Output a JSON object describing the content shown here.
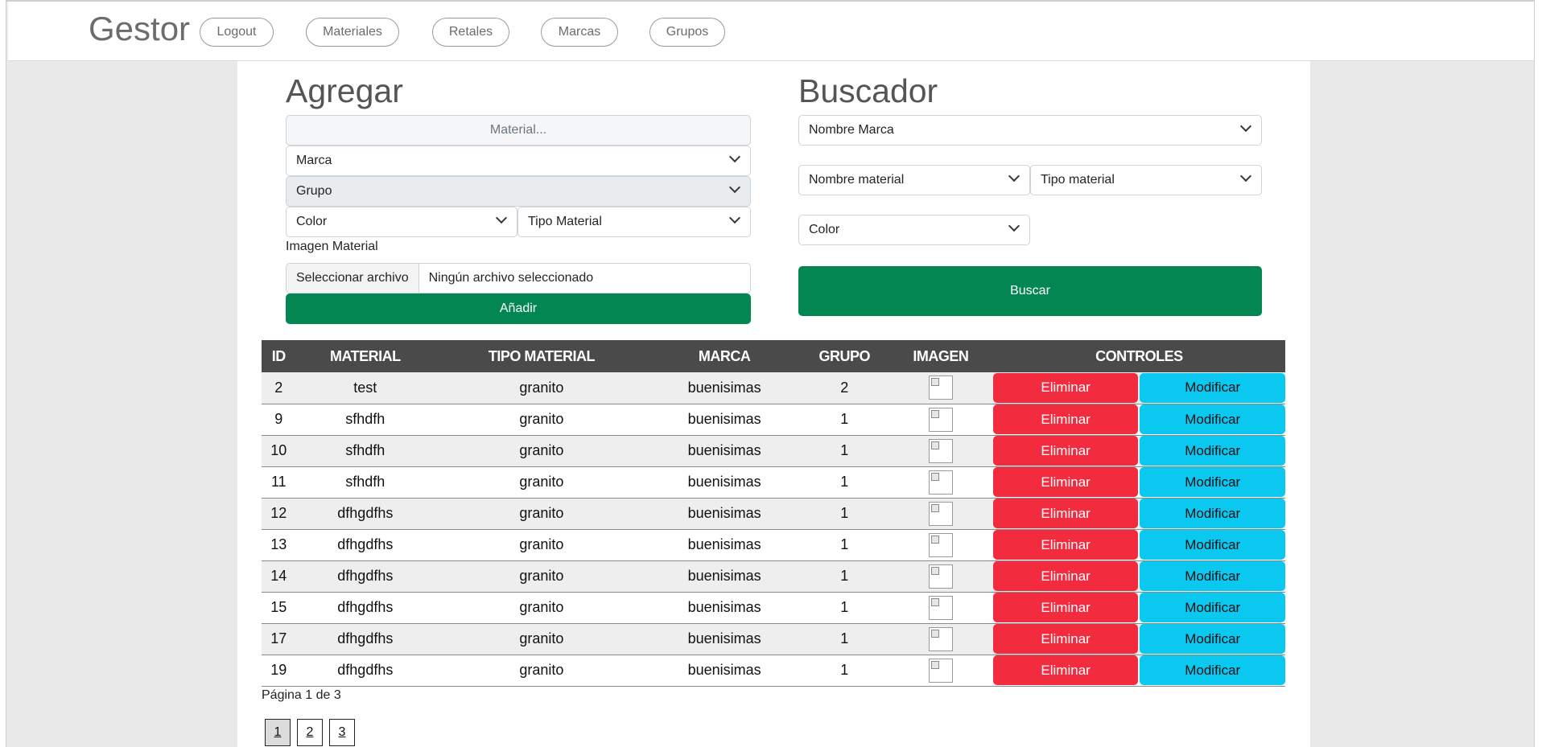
{
  "navbar": {
    "brand": "Gestor",
    "items": [
      "Logout",
      "Materiales",
      "Retales",
      "Marcas",
      "Grupos"
    ]
  },
  "agregar": {
    "title": "Agregar",
    "material_placeholder": "Material...",
    "marca": "Marca",
    "grupo": "Grupo",
    "color": "Color",
    "tipo_material": "Tipo Material",
    "imagen_label": "Imagen Material",
    "file_button": "Seleccionar archivo",
    "file_status": "Ningún archivo seleccionado",
    "submit": "Añadir"
  },
  "buscador": {
    "title": "Buscador",
    "nombre_marca": "Nombre Marca",
    "nombre_material": "Nombre material",
    "tipo_material": "Tipo material",
    "color": "Color",
    "submit": "Buscar"
  },
  "table": {
    "headers": [
      "ID",
      "MATERIAL",
      "TIPO MATERIAL",
      "MARCA",
      "GRUPO",
      "IMAGEN",
      "CONTROLES"
    ],
    "delete_label": "Eliminar",
    "modify_label": "Modificar",
    "rows": [
      {
        "id": "2",
        "material": "test",
        "tipo": "granito",
        "marca": "buenisimas",
        "grupo": "2"
      },
      {
        "id": "9",
        "material": "sfhdfh",
        "tipo": "granito",
        "marca": "buenisimas",
        "grupo": "1"
      },
      {
        "id": "10",
        "material": "sfhdfh",
        "tipo": "granito",
        "marca": "buenisimas",
        "grupo": "1"
      },
      {
        "id": "11",
        "material": "sfhdfh",
        "tipo": "granito",
        "marca": "buenisimas",
        "grupo": "1"
      },
      {
        "id": "12",
        "material": "dfhgdfhs",
        "tipo": "granito",
        "marca": "buenisimas",
        "grupo": "1"
      },
      {
        "id": "13",
        "material": "dfhgdfhs",
        "tipo": "granito",
        "marca": "buenisimas",
        "grupo": "1"
      },
      {
        "id": "14",
        "material": "dfhgdfhs",
        "tipo": "granito",
        "marca": "buenisimas",
        "grupo": "1"
      },
      {
        "id": "15",
        "material": "dfhgdfhs",
        "tipo": "granito",
        "marca": "buenisimas",
        "grupo": "1"
      },
      {
        "id": "17",
        "material": "dfhgdfhs",
        "tipo": "granito",
        "marca": "buenisimas",
        "grupo": "1"
      },
      {
        "id": "19",
        "material": "dfhgdfhs",
        "tipo": "granito",
        "marca": "buenisimas",
        "grupo": "1"
      }
    ]
  },
  "pagination": {
    "info": "Página 1 de 3",
    "pages": [
      "1",
      "2",
      "3"
    ],
    "current": "1"
  },
  "colors": {
    "green": "#028752",
    "danger": "#f22b3f",
    "info": "#0bc8f1",
    "table_header": "#4a4a4a"
  }
}
